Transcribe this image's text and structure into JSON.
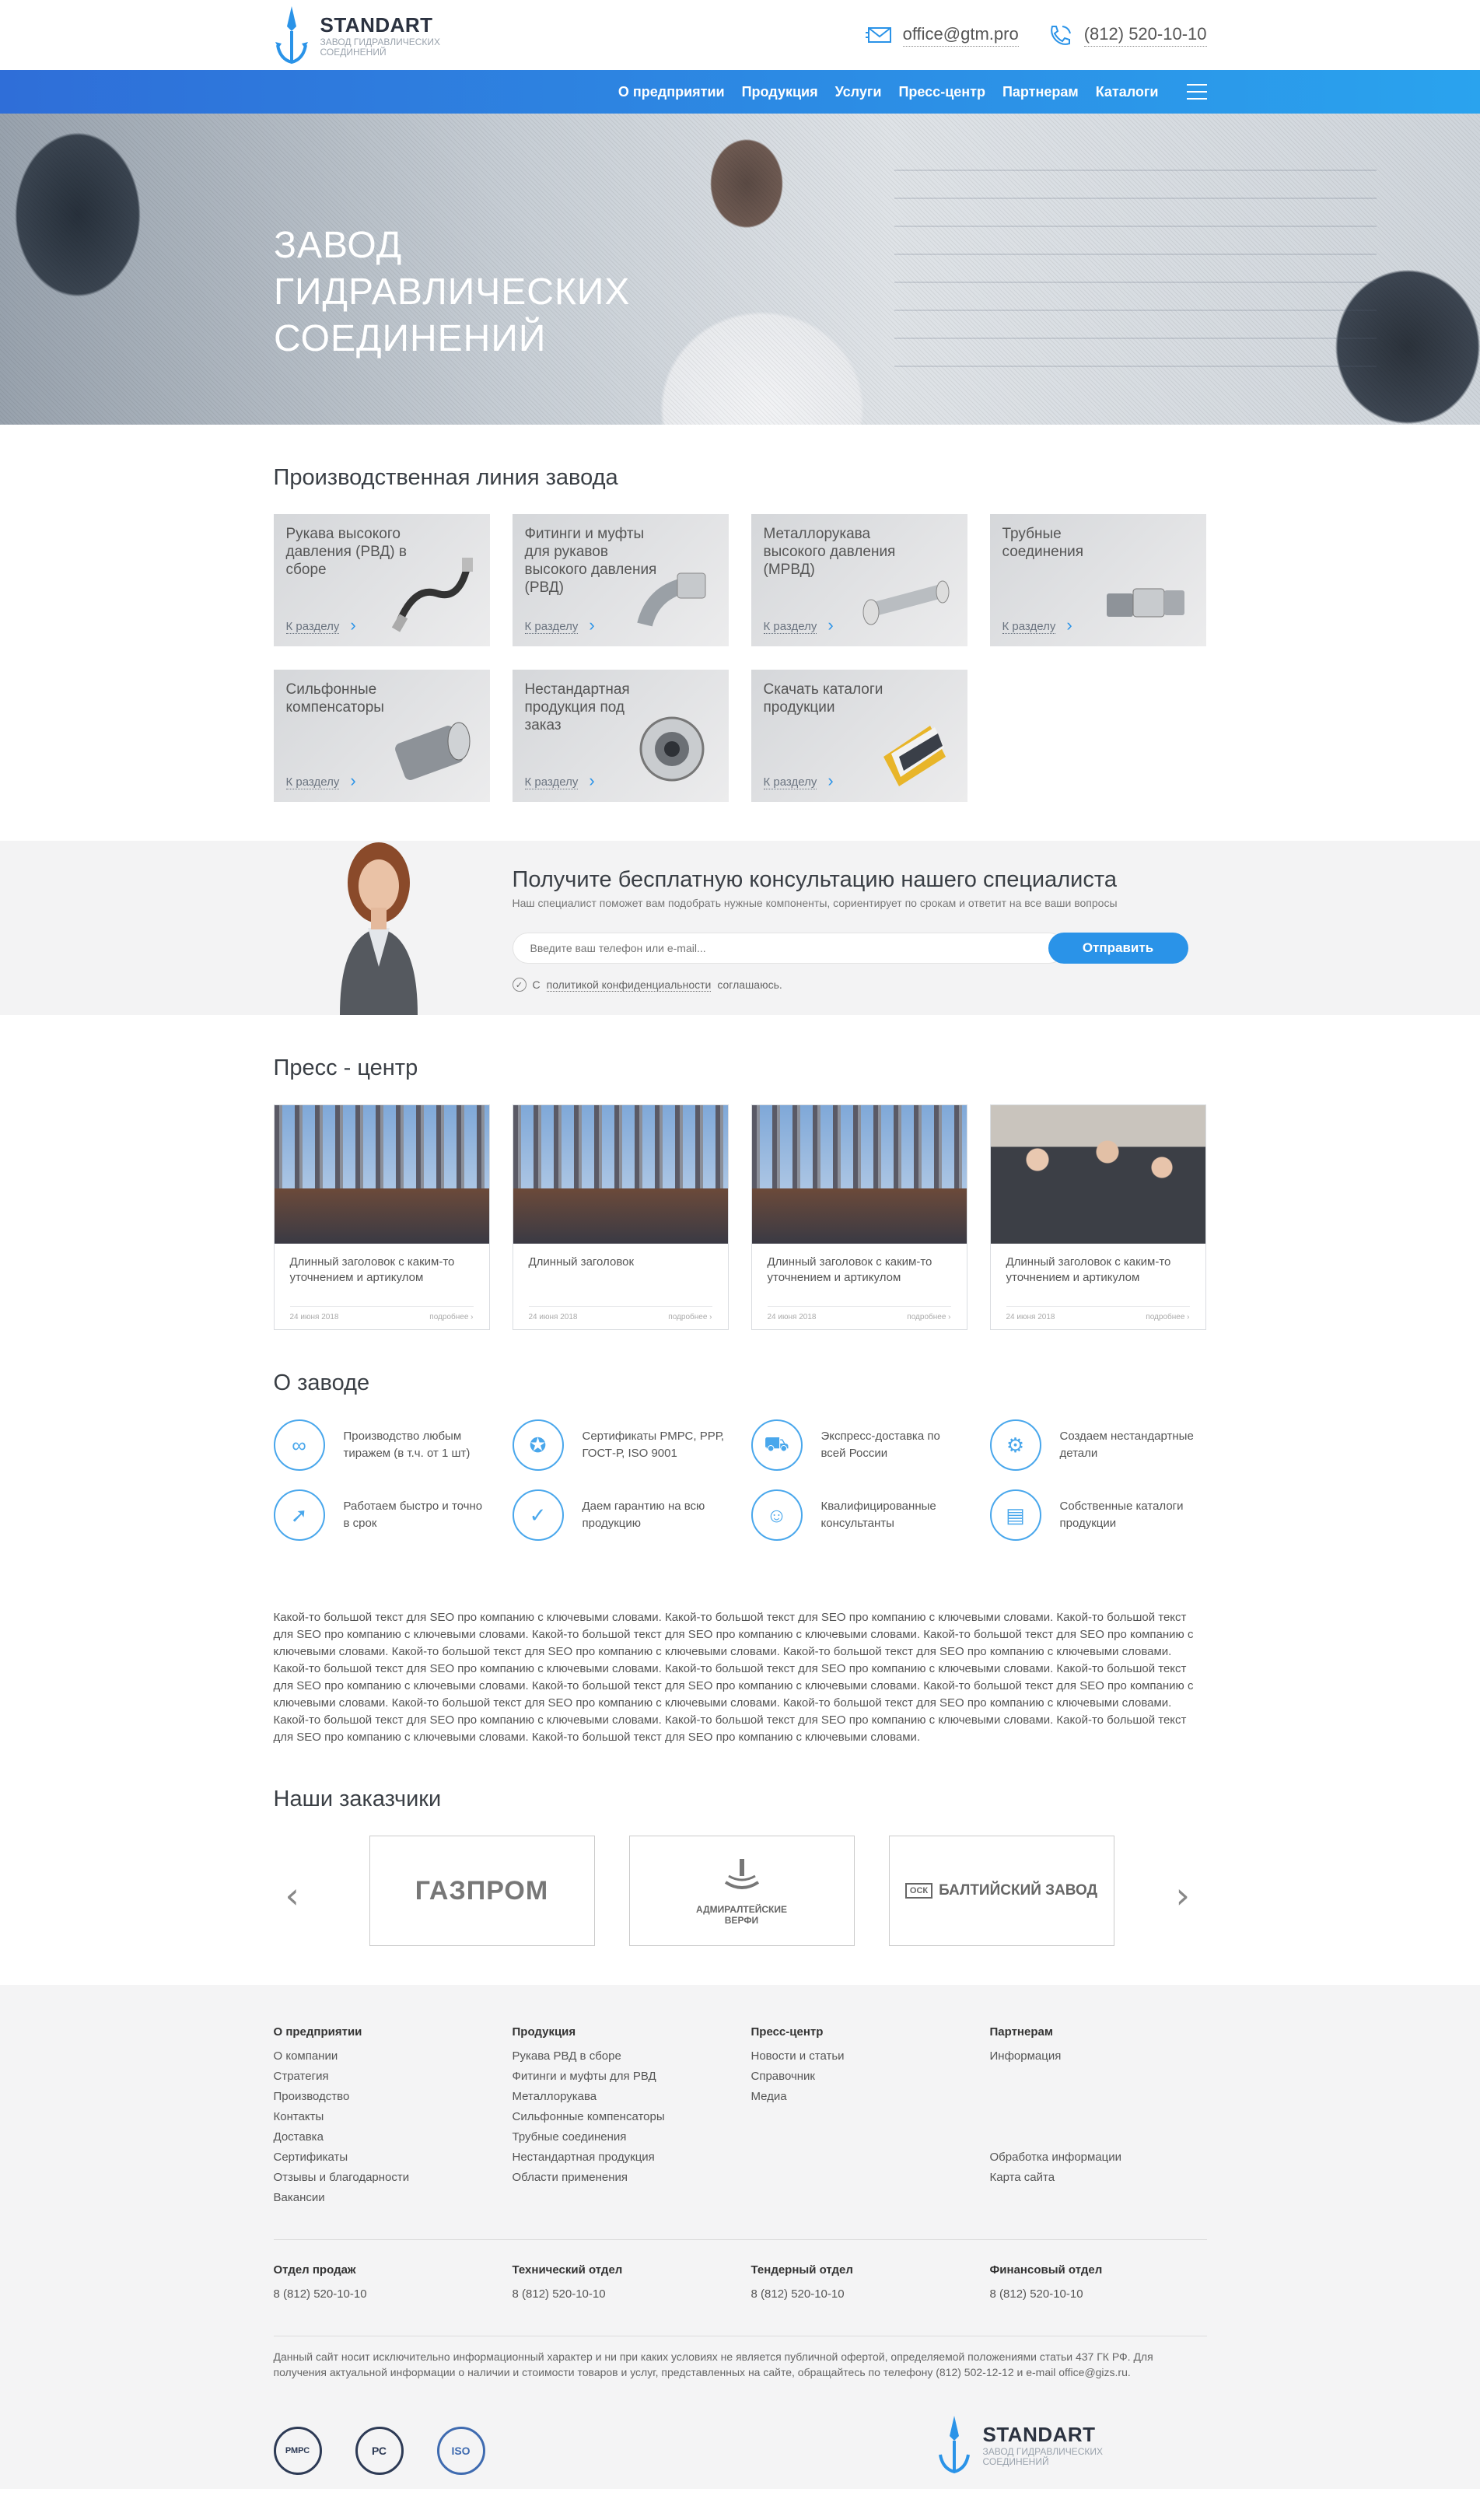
{
  "header": {
    "logo_title": "STANDART",
    "logo_sub": "ЗАВОД ГИДРАВЛИЧЕСКИХ СОЕДИНЕНИЙ",
    "email": "office@gtm.pro",
    "phone": "(812) 520-10-10"
  },
  "nav": [
    "О предприятии",
    "Продукция",
    "Услуги",
    "Пресс-центр",
    "Партнерам",
    "Каталоги"
  ],
  "hero": {
    "title_line1": "ЗАВОД",
    "title_line2": "ГИДРАВЛИЧЕСКИХ",
    "title_line3": "СОЕДИНЕНИЙ"
  },
  "production": {
    "title": "Производственная линия завода",
    "link_label": "К разделу",
    "items": [
      "Рукава высокого давления (РВД) в сборе",
      "Фитинги и муфты для рукавов высокого давления (РВД)",
      "Металлорукава высокого давления (МРВД)",
      "Трубные соединения",
      "Сильфонные компенсаторы",
      "Нестандартная продукция под заказ",
      "Скачать каталоги продукции"
    ]
  },
  "consult": {
    "title": "Получите бесплатную консультацию нашего специалиста",
    "subtitle": "Наш специалист поможет вам подобрать нужные компоненты, сориентирует по срокам и ответит на все ваши вопросы",
    "placeholder": "Введите ваш телефон или e-mail...",
    "button": "Отправить",
    "agree_pre": "С",
    "agree_link": "политикой конфиденциальности",
    "agree_post": "соглашаюсь."
  },
  "press": {
    "title": "Пресс - центр",
    "more": "подробнее",
    "cards": [
      {
        "title": "Длинный заголовок с каким-то уточнением и артикулом",
        "date": "24 июня 2018"
      },
      {
        "title": "Длинный заголовок",
        "date": "24 июня 2018"
      },
      {
        "title": "Длинный заголовок с каким-то уточнением и артикулом",
        "date": "24 июня 2018"
      },
      {
        "title": "Длинный заголовок с каким-то уточнением и артикулом",
        "date": "24 июня 2018"
      }
    ]
  },
  "about": {
    "title": "О заводе",
    "features": [
      {
        "text": "Производство любым тиражем (в т.ч. от 1 шт)",
        "icon": "infinity-icon"
      },
      {
        "text": "Сертификаты РМРС, РРР, ГОСТ-Р, ISO 9001",
        "icon": "certificate-icon"
      },
      {
        "text": "Экспресс-доставка по всей России",
        "icon": "truck-icon"
      },
      {
        "text": "Создаем нестандартные детали",
        "icon": "gears-icon"
      },
      {
        "text": "Работаем быстро и точно в срок",
        "icon": "rocket-icon"
      },
      {
        "text": "Даем гарантию на всю продукцию",
        "icon": "shield-check-icon"
      },
      {
        "text": "Квалифицированные консультанты",
        "icon": "consultant-icon"
      },
      {
        "text": "Собственные каталоги продукции",
        "icon": "book-icon"
      }
    ]
  },
  "seo_text": "Какой-то большой текст для SEO про компанию с ключевыми словами. Какой-то большой текст для SEO про компанию с ключевыми словами. Какой-то большой текст для SEO про компанию с ключевыми словами. Какой-то большой текст для SEO про компанию с ключевыми словами. Какой-то большой текст для SEO про компанию с ключевыми словами. Какой-то большой текст для SEO про компанию с ключевыми словами. Какой-то большой текст для SEO про компанию с ключевыми словами. Какой-то большой текст для SEO про компанию с ключевыми словами. Какой-то большой текст для SEO про компанию с ключевыми словами. Какой-то большой текст для SEO про компанию с ключевыми словами. Какой-то большой текст для SEO про компанию с ключевыми словами. Какой-то большой текст для SEO про компанию с ключевыми словами. Какой-то большой текст для SEO про компанию с ключевыми словами. Какой-то большой текст для SEO про компанию с ключевыми словами. Какой-то большой текст для SEO про компанию с ключевыми словами. Какой-то большой текст для SEO про компанию с ключевыми словами. Какой-то большой текст для SEO про компанию с ключевыми словами. Какой-то большой текст для SEO про компанию с ключевыми словами.",
  "clients": {
    "title": "Наши заказчики",
    "logos": [
      "ГАЗПРОМ",
      "АДМИРАЛТЕЙСКИЕ ВЕРФИ",
      "БАЛТИЙСКИЙ ЗАВОД"
    ],
    "logo_prefix": "ОСК"
  },
  "footer": {
    "cols": [
      {
        "head": "О предприятии",
        "items": [
          "О компании",
          "Стратегия",
          "Производство",
          "Контакты",
          "Доставка",
          "Сертификаты",
          "Отзывы и благодарности",
          "Вакансии"
        ]
      },
      {
        "head": "Продукция",
        "items": [
          "Рукава РВД в сборе",
          "Фитинги и муфты для РВД",
          "Металлорукава",
          "Сильфонные компенсаторы",
          "Трубные соединения",
          "Нестандартная продукция",
          "Области применения"
        ]
      },
      {
        "head": "Пресс-центр",
        "items": [
          "Новости и статьи",
          "Справочник",
          "Медиа"
        ]
      },
      {
        "head": "Партнерам",
        "items": [
          "Информация"
        ]
      }
    ],
    "extra_links": [
      "Обработка информации",
      "Карта сайта"
    ],
    "departments": [
      {
        "name": "Отдел продаж",
        "phone": "8 (812) 520-10-10"
      },
      {
        "name": "Технический отдел",
        "phone": "8 (812) 520-10-10"
      },
      {
        "name": "Тендерный отдел",
        "phone": "8 (812) 520-10-10"
      },
      {
        "name": "Финансовый отдел",
        "phone": "8 (812) 520-10-10"
      }
    ],
    "disclaimer": "Данный сайт носит исключительно информационный характер и ни при каких условиях не является публичной офертой, определяемой положениями статьи 437 ГК РФ. Для получения актуальной информации о наличии и стоимости товаров и услуг, представленных на сайте, обращайтесь по телефону (812) 502-12-12 и e-mail office@gizs.ru.",
    "cert_labels": [
      "РМРС",
      "РС",
      "ISO"
    ],
    "logo_title": "STANDART",
    "logo_sub": "ЗАВОД ГИДРАВЛИЧЕСКИХ СОЕДИНЕНИЙ"
  },
  "colors": {
    "accent": "#2a93e8",
    "nav_start": "#2f6ed8",
    "nav_end": "#2aa3ee",
    "footer_bg": "#f4f4f5"
  }
}
